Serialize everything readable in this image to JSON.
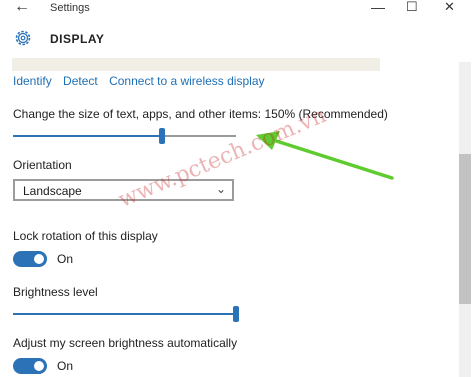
{
  "window": {
    "app_title": "Settings",
    "back_icon": "arrow-left-icon",
    "minimize_icon": "minimize-icon",
    "maximize_icon": "maximize-icon",
    "close_icon": "close-icon"
  },
  "header": {
    "title": "DISPLAY",
    "icon": "gear-icon"
  },
  "links": [
    "Identify",
    "Detect",
    "Connect to a wireless display"
  ],
  "scale": {
    "label": "Change the size of text, apps, and other items: 150% (Recommended)",
    "value_fraction": 0.67
  },
  "orientation": {
    "label": "Orientation",
    "selected": "Landscape"
  },
  "lock_rotation": {
    "label": "Lock rotation of this display",
    "state": "On"
  },
  "brightness": {
    "label": "Brightness level",
    "value_fraction": 1.0
  },
  "auto_brightness": {
    "label": "Adjust my screen brightness automatically",
    "state": "On"
  },
  "watermark": "www.pctech.com.vn",
  "colors": {
    "accent": "#2c72b6",
    "link": "#1f6fb5",
    "arrow": "#5ecb2e",
    "watermark": "#c82828"
  }
}
